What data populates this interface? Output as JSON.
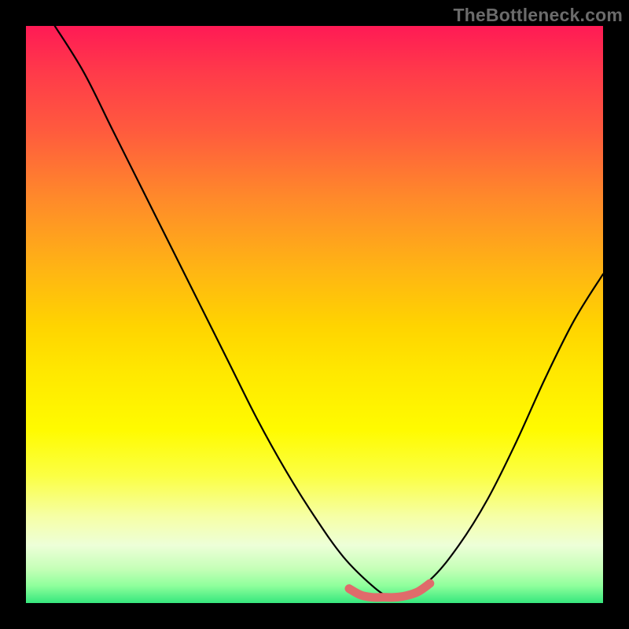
{
  "watermark": "TheBottleneck.com",
  "chart_data": {
    "type": "line",
    "title": "",
    "xlabel": "",
    "ylabel": "",
    "xlim": [
      0,
      100
    ],
    "ylim": [
      0,
      100
    ],
    "grid": false,
    "legend": false,
    "series": [
      {
        "name": "bottleneck-curve",
        "stroke": "#000000",
        "x": [
          5,
          10,
          15,
          20,
          25,
          30,
          35,
          40,
          45,
          50,
          55,
          60,
          63,
          65,
          70,
          75,
          80,
          85,
          90,
          95,
          100
        ],
        "y": [
          100,
          92,
          82,
          72,
          62,
          52,
          42,
          32,
          23,
          15,
          8,
          3,
          1,
          1,
          4,
          10,
          18,
          28,
          39,
          49,
          57
        ]
      },
      {
        "name": "optimal-flat-segment",
        "stroke": "#e06b6b",
        "thick": true,
        "x": [
          56,
          58,
          60,
          62,
          64,
          66,
          68,
          70
        ],
        "y": [
          2.5,
          1.4,
          1.0,
          1.0,
          1.0,
          1.3,
          2.0,
          3.4
        ]
      }
    ],
    "gradient_stops": [
      {
        "pos": 0,
        "color": "#ff1a55"
      },
      {
        "pos": 8,
        "color": "#ff3a4a"
      },
      {
        "pos": 18,
        "color": "#ff5a3e"
      },
      {
        "pos": 30,
        "color": "#ff8a2a"
      },
      {
        "pos": 42,
        "color": "#ffb414"
      },
      {
        "pos": 52,
        "color": "#ffd400"
      },
      {
        "pos": 60,
        "color": "#ffe800"
      },
      {
        "pos": 70,
        "color": "#fffb00"
      },
      {
        "pos": 78,
        "color": "#fbff44"
      },
      {
        "pos": 85,
        "color": "#f6ffa6"
      },
      {
        "pos": 90,
        "color": "#edffd8"
      },
      {
        "pos": 94,
        "color": "#c6ffb8"
      },
      {
        "pos": 97,
        "color": "#8fff9c"
      },
      {
        "pos": 100,
        "color": "#36e77d"
      }
    ]
  }
}
